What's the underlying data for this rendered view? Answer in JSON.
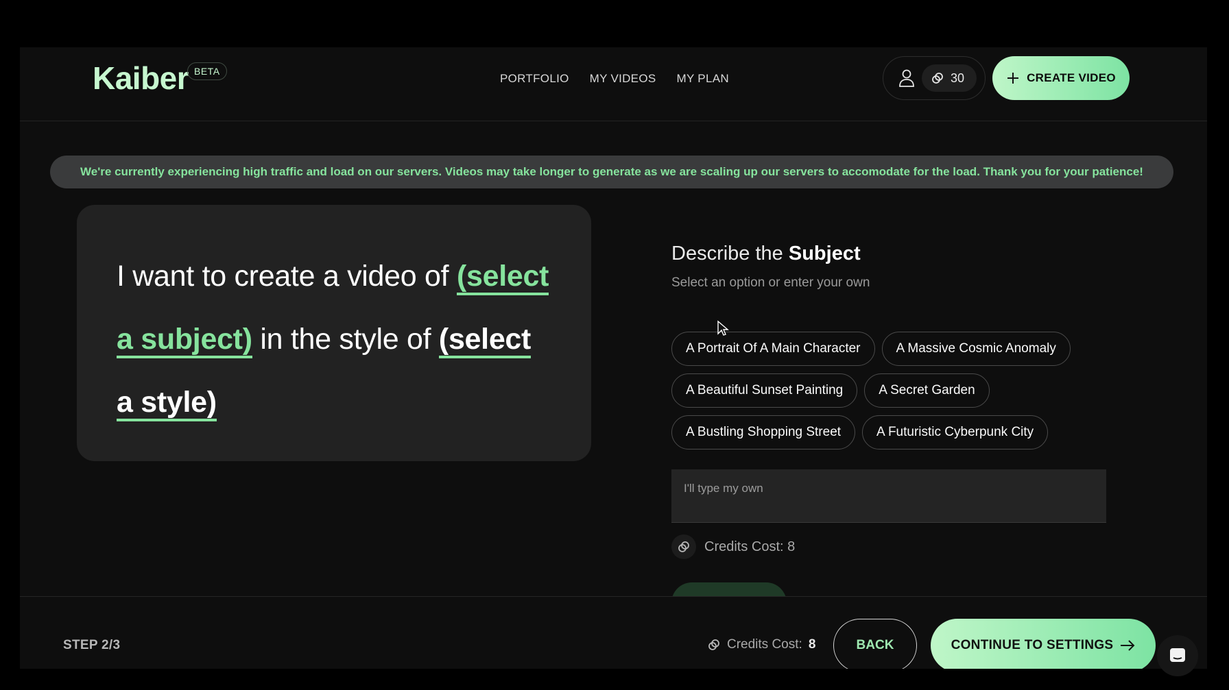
{
  "header": {
    "logo": "Kaiber",
    "beta_badge": "BETA",
    "nav": [
      "PORTFOLIO",
      "MY VIDEOS",
      "MY PLAN"
    ],
    "credits_balance": "30",
    "create_label": "CREATE VIDEO"
  },
  "banner": {
    "text": "We're currently experiencing high traffic and load on our servers. Videos may take longer to generate as we are scaling up our servers to accomodate for the load. Thank you for your patience!"
  },
  "prompt": {
    "prefix": "I want to create a video of",
    "subject_placeholder": "(select a subject)",
    "middle": "in the style of",
    "style_placeholder": "(select a style)"
  },
  "question": {
    "title_prefix": "Describe the",
    "title_bold": "Subject",
    "subtitle": "Select an option or enter your own",
    "options": [
      [
        "A Portrait Of A Main Character",
        "A Massive Cosmic Anomaly"
      ],
      [
        "A Beautiful Sunset Painting",
        "A Secret Garden"
      ],
      [
        "A Bustling Shopping Street",
        "A Futuristic Cyberpunk City"
      ]
    ],
    "own_placeholder": "I'll type my own",
    "credits_cost": "Credits Cost: 8"
  },
  "footer": {
    "step": "STEP 2/3",
    "credits_label": "Credits Cost:",
    "credits_value": "8",
    "back_label": "BACK",
    "continue_label": "CONTINUE TO SETTINGS"
  },
  "colors": {
    "accent": "#86e39d",
    "button_gradient_start": "#bff6c8",
    "button_gradient_end": "#7de3a3",
    "banner_bg": "#3a3b3c"
  }
}
